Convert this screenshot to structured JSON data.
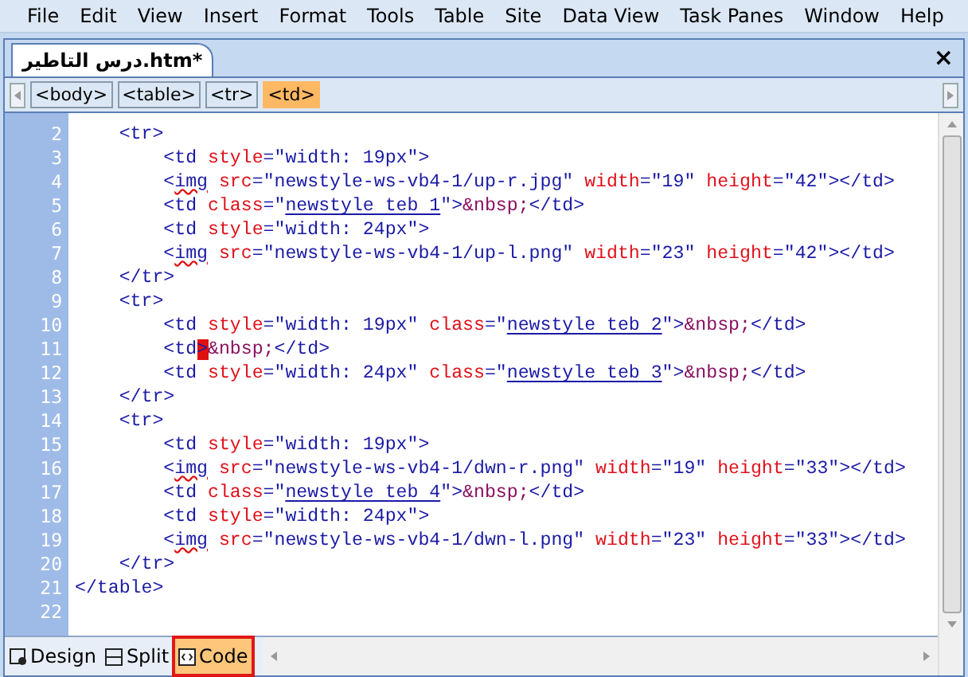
{
  "menu_bar": [
    "File",
    "Edit",
    "View",
    "Insert",
    "Format",
    "Tools",
    "Table",
    "Site",
    "Data View",
    "Task Panes",
    "Window",
    "Help"
  ],
  "document_tabs": [
    {
      "label": "درس التاطير.htm*",
      "selected": true
    }
  ],
  "close_button": "×",
  "tag_selector": [
    {
      "label": "<body>",
      "selected": false
    },
    {
      "label": "<table>",
      "selected": false
    },
    {
      "label": "<tr>",
      "selected": false
    },
    {
      "label": "<td>",
      "selected": true
    }
  ],
  "code_lines": [
    {
      "children": [
        {
          "number": "2",
          "tokens": [
            {
              "kind": "tag",
              "text": "<tr>"
            }
          ],
          "children": [
            {
              "number": "3",
              "tokens": [
                {
                  "kind": "tag",
                  "text": "<td"
                },
                {
                  "kind": "attr",
                  "text": " style"
                },
                {
                  "kind": "tag",
                  "text": "="
                },
                {
                  "kind": "value",
                  "text": "\"width: 19px\""
                },
                {
                  "kind": "tag",
                  "text": ">"
                }
              ]
            },
            {
              "number": "4",
              "tokens": [
                {
                  "kind": "tag",
                  "text": "<"
                },
                {
                  "kind": "misspelled",
                  "text": "img"
                },
                {
                  "kind": "attr",
                  "text": " src"
                },
                {
                  "kind": "tag",
                  "text": "="
                },
                {
                  "kind": "value",
                  "text": "\"newstyle-ws-vb4-1/up-r.jpg\""
                },
                {
                  "kind": "attr",
                  "text": " width"
                },
                {
                  "kind": "tag",
                  "text": "="
                },
                {
                  "kind": "value",
                  "text": "\"19\""
                },
                {
                  "kind": "attr",
                  "text": " height"
                },
                {
                  "kind": "tag",
                  "text": "="
                },
                {
                  "kind": "value",
                  "text": "\"42\""
                },
                {
                  "kind": "tag",
                  "text": "></td>"
                }
              ]
            },
            {
              "number": "5",
              "tokens": [
                {
                  "kind": "tag",
                  "text": "<td"
                },
                {
                  "kind": "attr",
                  "text": " class"
                },
                {
                  "kind": "tag",
                  "text": "=\""
                },
                {
                  "kind": "link",
                  "text": "newstyle teb 1"
                },
                {
                  "kind": "tag",
                  "text": "\">"
                },
                {
                  "kind": "entity",
                  "text": "&nbsp;"
                },
                {
                  "kind": "tag",
                  "text": "</td>"
                }
              ]
            },
            {
              "number": "6",
              "tokens": [
                {
                  "kind": "tag",
                  "text": "<td"
                },
                {
                  "kind": "attr",
                  "text": " style"
                },
                {
                  "kind": "tag",
                  "text": "="
                },
                {
                  "kind": "value",
                  "text": "\"width: 24px\""
                },
                {
                  "kind": "tag",
                  "text": ">"
                }
              ]
            },
            {
              "number": "7",
              "tokens": [
                {
                  "kind": "tag",
                  "text": "<"
                },
                {
                  "kind": "misspelled",
                  "text": "img"
                },
                {
                  "kind": "attr",
                  "text": " src"
                },
                {
                  "kind": "tag",
                  "text": "="
                },
                {
                  "kind": "value",
                  "text": "\"newstyle-ws-vb4-1/up-l.png\""
                },
                {
                  "kind": "attr",
                  "text": " width"
                },
                {
                  "kind": "tag",
                  "text": "="
                },
                {
                  "kind": "value",
                  "text": "\"23\""
                },
                {
                  "kind": "attr",
                  "text": " height"
                },
                {
                  "kind": "tag",
                  "text": "="
                },
                {
                  "kind": "value",
                  "text": "\"42\""
                },
                {
                  "kind": "tag",
                  "text": "></td>"
                }
              ]
            }
          ]
        },
        {
          "number": "8",
          "tokens": [
            {
              "kind": "tag",
              "text": "</tr>"
            }
          ]
        },
        {
          "number": "9",
          "tokens": [
            {
              "kind": "tag",
              "text": "<tr>"
            }
          ],
          "children": [
            {
              "number": "10",
              "tokens": [
                {
                  "kind": "tag",
                  "text": "<td"
                },
                {
                  "kind": "attr",
                  "text": " style"
                },
                {
                  "kind": "tag",
                  "text": "="
                },
                {
                  "kind": "value",
                  "text": "\"width: 19px\""
                },
                {
                  "kind": "attr",
                  "text": " class"
                },
                {
                  "kind": "tag",
                  "text": "=\""
                },
                {
                  "kind": "link",
                  "text": "newstyle teb 2"
                },
                {
                  "kind": "tag",
                  "text": "\">"
                },
                {
                  "kind": "entity",
                  "text": "&nbsp;"
                },
                {
                  "kind": "tag",
                  "text": "</td>"
                }
              ]
            },
            {
              "number": "11",
              "tokens": [
                {
                  "kind": "tag",
                  "text": "<td"
                },
                {
                  "kind": "cursor",
                  "text": ">"
                },
                {
                  "kind": "entity",
                  "text": "&nbsp;"
                },
                {
                  "kind": "tag",
                  "text": "</td>"
                }
              ]
            },
            {
              "number": "12",
              "tokens": [
                {
                  "kind": "tag",
                  "text": "<td"
                },
                {
                  "kind": "attr",
                  "text": " style"
                },
                {
                  "kind": "tag",
                  "text": "="
                },
                {
                  "kind": "value",
                  "text": "\"width: 24px\""
                },
                {
                  "kind": "attr",
                  "text": " class"
                },
                {
                  "kind": "tag",
                  "text": "=\""
                },
                {
                  "kind": "link",
                  "text": "newstyle teb 3"
                },
                {
                  "kind": "tag",
                  "text": "\">"
                },
                {
                  "kind": "entity",
                  "text": "&nbsp;"
                },
                {
                  "kind": "tag",
                  "text": "</td>"
                }
              ]
            }
          ]
        },
        {
          "number": "13",
          "tokens": [
            {
              "kind": "tag",
              "text": "</tr>"
            }
          ]
        },
        {
          "number": "14",
          "tokens": [
            {
              "kind": "tag",
              "text": "<tr>"
            }
          ],
          "children": [
            {
              "number": "15",
              "tokens": [
                {
                  "kind": "tag",
                  "text": "<td"
                },
                {
                  "kind": "attr",
                  "text": " style"
                },
                {
                  "kind": "tag",
                  "text": "="
                },
                {
                  "kind": "value",
                  "text": "\"width: 19px\""
                },
                {
                  "kind": "tag",
                  "text": ">"
                }
              ]
            },
            {
              "number": "16",
              "tokens": [
                {
                  "kind": "tag",
                  "text": "<"
                },
                {
                  "kind": "misspelled",
                  "text": "img"
                },
                {
                  "kind": "attr",
                  "text": " src"
                },
                {
                  "kind": "tag",
                  "text": "="
                },
                {
                  "kind": "value",
                  "text": "\"newstyle-ws-vb4-1/dwn-r.png\""
                },
                {
                  "kind": "attr",
                  "text": " width"
                },
                {
                  "kind": "tag",
                  "text": "="
                },
                {
                  "kind": "value",
                  "text": "\"19\""
                },
                {
                  "kind": "attr",
                  "text": " height"
                },
                {
                  "kind": "tag",
                  "text": "="
                },
                {
                  "kind": "value",
                  "text": "\"33\""
                },
                {
                  "kind": "tag",
                  "text": "></td>"
                }
              ]
            },
            {
              "number": "17",
              "tokens": [
                {
                  "kind": "tag",
                  "text": "<td"
                },
                {
                  "kind": "attr",
                  "text": " class"
                },
                {
                  "kind": "tag",
                  "text": "=\""
                },
                {
                  "kind": "link",
                  "text": "newstyle teb 4"
                },
                {
                  "kind": "tag",
                  "text": "\">"
                },
                {
                  "kind": "entity",
                  "text": "&nbsp;"
                },
                {
                  "kind": "tag",
                  "text": "</td>"
                }
              ]
            },
            {
              "number": "18",
              "tokens": [
                {
                  "kind": "tag",
                  "text": "<td"
                },
                {
                  "kind": "attr",
                  "text": " style"
                },
                {
                  "kind": "tag",
                  "text": "="
                },
                {
                  "kind": "value",
                  "text": "\"width: 24px\""
                },
                {
                  "kind": "tag",
                  "text": ">"
                }
              ]
            },
            {
              "number": "19",
              "tokens": [
                {
                  "kind": "tag",
                  "text": "<"
                },
                {
                  "kind": "misspelled",
                  "text": "img"
                },
                {
                  "kind": "attr",
                  "text": " src"
                },
                {
                  "kind": "tag",
                  "text": "="
                },
                {
                  "kind": "value",
                  "text": "\"newstyle-ws-vb4-1/dwn-l.png\""
                },
                {
                  "kind": "attr",
                  "text": " width"
                },
                {
                  "kind": "tag",
                  "text": "="
                },
                {
                  "kind": "value",
                  "text": "\"23\""
                },
                {
                  "kind": "attr",
                  "text": " height"
                },
                {
                  "kind": "tag",
                  "text": "="
                },
                {
                  "kind": "value",
                  "text": "\"33\""
                },
                {
                  "kind": "tag",
                  "text": "></td>"
                }
              ]
            }
          ]
        },
        {
          "number": "20",
          "tokens": [
            {
              "kind": "tag",
              "text": "</tr>"
            }
          ]
        }
      ]
    },
    {
      "number": "21",
      "tokens": [
        {
          "kind": "tag",
          "text": "</table>"
        }
      ]
    },
    {
      "number": "22"
    }
  ],
  "view_tabs": [
    {
      "kind": "design",
      "label": "Design",
      "selected": false
    },
    {
      "kind": "split",
      "label": "Split",
      "selected": false
    },
    {
      "kind": "code",
      "label": "Code",
      "selected": true
    }
  ]
}
